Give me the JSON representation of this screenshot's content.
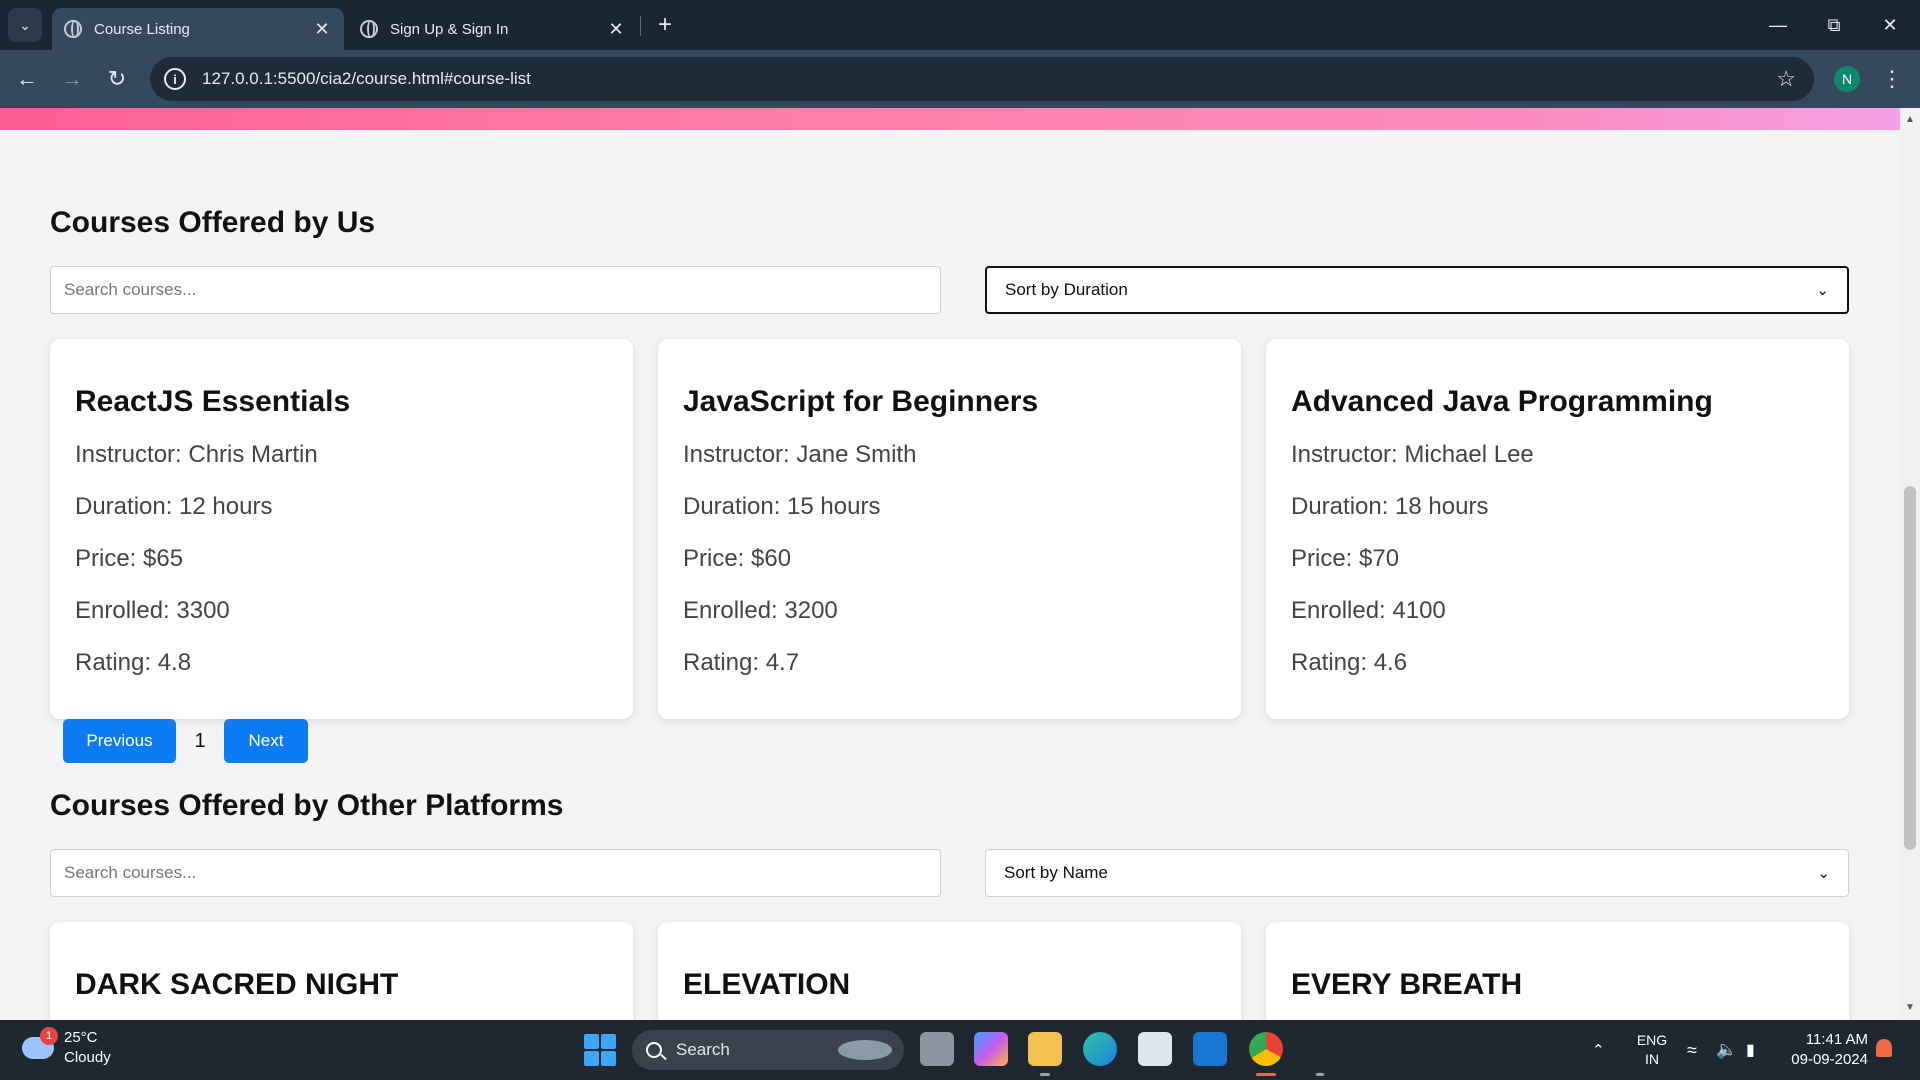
{
  "browser": {
    "tabs": [
      {
        "title": "Course Listing",
        "active": true
      },
      {
        "title": "Sign Up & Sign In",
        "active": false
      }
    ],
    "url": "127.0.0.1:5500/cia2/course.html#course-list",
    "profile_initial": "N"
  },
  "page": {
    "accent_pink": "#fe7ea7",
    "button_blue": "#0d7cf2",
    "our_courses": {
      "title": "Courses Offered by Us",
      "search_placeholder": "Search courses...",
      "sort_label": "Sort by Duration",
      "cards": [
        {
          "name": "ReactJS Essentials",
          "instructor": "Instructor: Chris Martin",
          "duration": "Duration: 12 hours",
          "price": "Price: $65",
          "enrolled": "Enrolled: 3300",
          "rating": "Rating: 4.8"
        },
        {
          "name": "JavaScript for Beginners",
          "instructor": "Instructor: Jane Smith",
          "duration": "Duration: 15 hours",
          "price": "Price: $60",
          "enrolled": "Enrolled: 3200",
          "rating": "Rating: 4.7"
        },
        {
          "name": "Advanced Java Programming",
          "instructor": "Instructor: Michael Lee",
          "duration": "Duration: 18 hours",
          "price": "Price: $70",
          "enrolled": "Enrolled: 4100",
          "rating": "Rating: 4.6"
        }
      ],
      "pagination": {
        "prev_label": "Previous",
        "page": "1",
        "next_label": "Next"
      }
    },
    "other_courses": {
      "title": "Courses Offered by Other Platforms",
      "search_placeholder": "Search courses...",
      "sort_label": "Sort by Name",
      "cards": [
        {
          "name": "DARK SACRED NIGHT"
        },
        {
          "name": "ELEVATION"
        },
        {
          "name": "EVERY BREATH"
        }
      ]
    }
  },
  "taskbar": {
    "weather_temp": "25°C",
    "weather_desc": "Cloudy",
    "weather_badge": "1",
    "search_label": "Search",
    "lang_top": "ENG",
    "lang_bottom": "IN",
    "time": "11:41 AM",
    "date": "09-09-2024"
  }
}
